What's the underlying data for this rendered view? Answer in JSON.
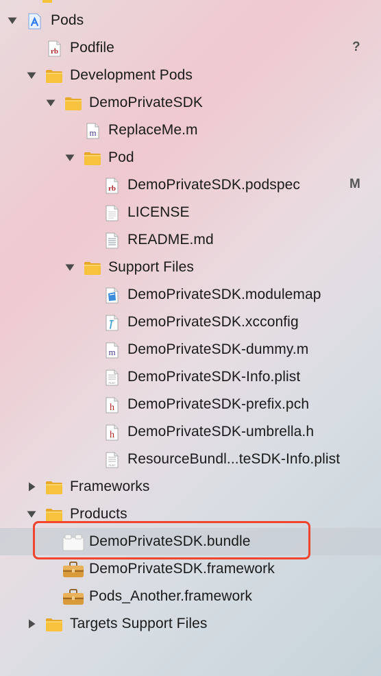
{
  "navigator": {
    "rows": [
      {
        "label": "Pods",
        "icon": "xcode-project-icon",
        "disclosure": "open",
        "indent": 0
      },
      {
        "label": "Podfile",
        "icon": "ruby-file-icon",
        "disclosure": "none",
        "indent": 1,
        "badge": "?"
      },
      {
        "label": "Development Pods",
        "icon": "folder-icon",
        "disclosure": "open",
        "indent": 1
      },
      {
        "label": "DemoPrivateSDK",
        "icon": "folder-icon",
        "disclosure": "open",
        "indent": 2
      },
      {
        "label": "ReplaceMe.m",
        "icon": "objc-file-icon",
        "disclosure": "none",
        "indent": 3
      },
      {
        "label": "Pod",
        "icon": "folder-icon",
        "disclosure": "open",
        "indent": 3
      },
      {
        "label": "DemoPrivateSDK.podspec",
        "icon": "ruby-file-icon",
        "disclosure": "none",
        "indent": 4,
        "badge": "M"
      },
      {
        "label": "LICENSE",
        "icon": "text-file-icon",
        "disclosure": "none",
        "indent": 4
      },
      {
        "label": "README.md",
        "icon": "markdown-file-icon",
        "disclosure": "none",
        "indent": 4
      },
      {
        "label": "Support Files",
        "icon": "folder-icon",
        "disclosure": "open",
        "indent": 3
      },
      {
        "label": "DemoPrivateSDK.modulemap",
        "icon": "modulemap-file-icon",
        "disclosure": "none",
        "indent": 4
      },
      {
        "label": "DemoPrivateSDK.xcconfig",
        "icon": "xcconfig-file-icon",
        "disclosure": "none",
        "indent": 4
      },
      {
        "label": "DemoPrivateSDK-dummy.m",
        "icon": "objc-file-icon",
        "disclosure": "none",
        "indent": 4
      },
      {
        "label": "DemoPrivateSDK-Info.plist",
        "icon": "plist-file-icon",
        "disclosure": "none",
        "indent": 4
      },
      {
        "label": "DemoPrivateSDK-prefix.pch",
        "icon": "header-file-icon",
        "disclosure": "none",
        "indent": 4
      },
      {
        "label": "DemoPrivateSDK-umbrella.h",
        "icon": "header-file-icon",
        "disclosure": "none",
        "indent": 4
      },
      {
        "label": "ResourceBundl...teSDK-Info.plist",
        "icon": "plist-file-icon",
        "disclosure": "none",
        "indent": 4
      },
      {
        "label": "Frameworks",
        "icon": "folder-icon",
        "disclosure": "closed",
        "indent": 1
      },
      {
        "label": "Products",
        "icon": "folder-icon",
        "disclosure": "open",
        "indent": 1
      },
      {
        "label": "DemoPrivateSDK.bundle",
        "icon": "bundle-icon",
        "disclosure": "none",
        "indent": 2,
        "selected": true
      },
      {
        "label": "DemoPrivateSDK.framework",
        "icon": "framework-icon",
        "disclosure": "none",
        "indent": 2
      },
      {
        "label": "Pods_Another.framework",
        "icon": "framework-icon",
        "disclosure": "none",
        "indent": 2
      },
      {
        "label": "Targets Support Files",
        "icon": "folder-icon",
        "disclosure": "closed",
        "indent": 1
      }
    ]
  },
  "colors": {
    "folder": "#f7c33f",
    "ruby": "#b1242b",
    "objc": "#4a3a8e",
    "header": "#b02424",
    "highlight": "#f0452c",
    "xcode_blue": "#2f7cf6"
  }
}
